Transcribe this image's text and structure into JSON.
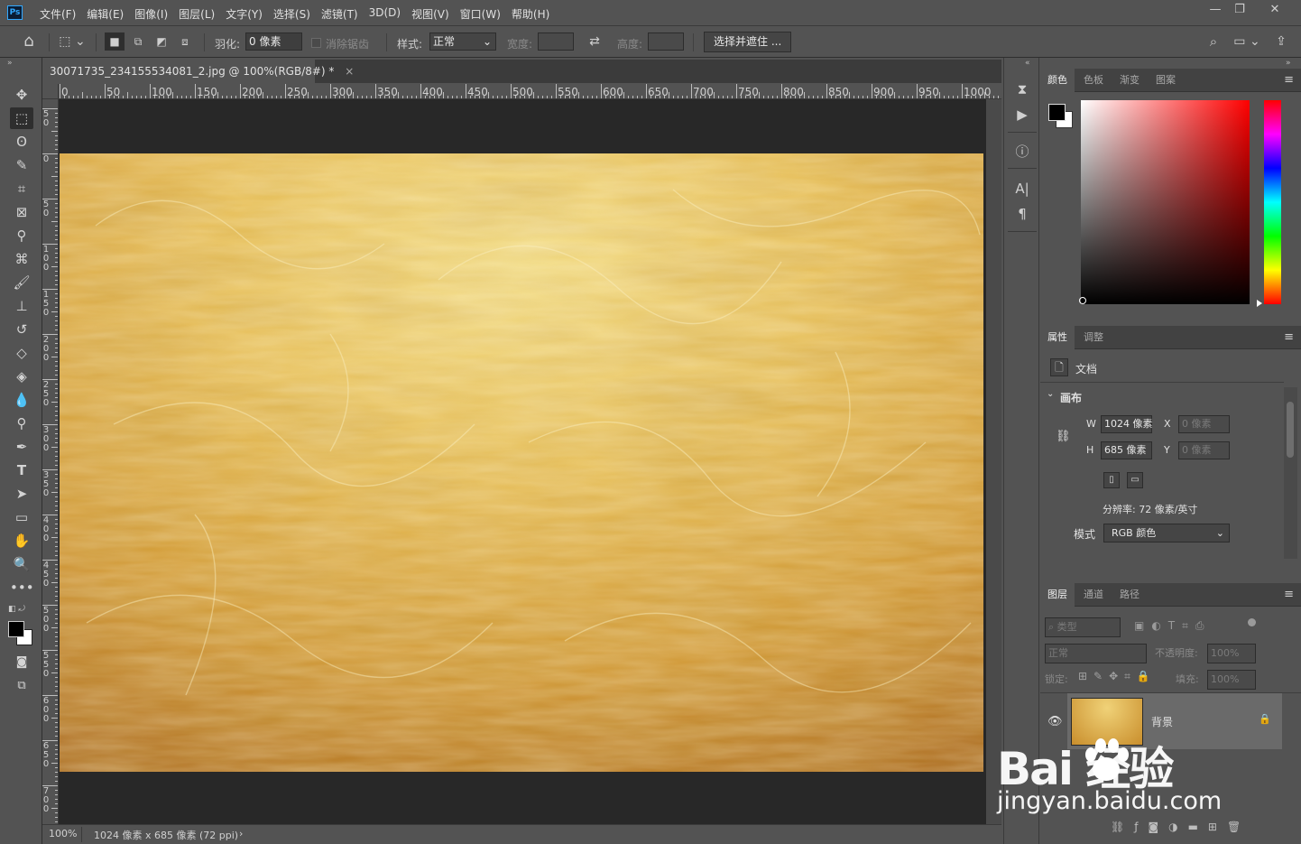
{
  "app": {
    "logo": "Ps"
  },
  "menu": [
    "文件(F)",
    "编辑(E)",
    "图像(I)",
    "图层(L)",
    "文字(Y)",
    "选择(S)",
    "滤镜(T)",
    "3D(D)",
    "视图(V)",
    "窗口(W)",
    "帮助(H)"
  ],
  "window_controls": {
    "minimize": "—",
    "restore": "❐",
    "close": "✕"
  },
  "options": {
    "feather_label": "羽化:",
    "feather_value": "0 像素",
    "antialias_label": "消除锯齿",
    "style_label": "样式:",
    "style_value": "正常",
    "width_label": "宽度:",
    "height_label": "高度:",
    "select_mask_button": "选择并遮住 ..."
  },
  "document_tab": {
    "title": "30071735_234155534081_2.jpg @ 100%(RGB/8#) *",
    "close": "×"
  },
  "ruler": {
    "h": [
      "0",
      "50",
      "100",
      "150",
      "200",
      "250",
      "300",
      "350",
      "400",
      "450",
      "500",
      "550",
      "600",
      "650",
      "700",
      "750",
      "800",
      "850",
      "900",
      "950",
      "1000"
    ],
    "v": [
      "50",
      "0",
      "50",
      "100",
      "150",
      "200",
      "250",
      "300",
      "350",
      "400",
      "450",
      "500",
      "550",
      "600",
      "650",
      "700"
    ]
  },
  "status": {
    "zoom": "100%",
    "dims": "1024 像素 x 685 像素 (72 ppi)",
    "arrow": "›"
  },
  "color_panel": {
    "tabs": [
      "颜色",
      "色板",
      "渐变",
      "图案"
    ]
  },
  "properties_panel": {
    "tabs": [
      "属性",
      "调整"
    ],
    "doc_label": "文档",
    "canvas_section": "画布",
    "w_label": "W",
    "w_value": "1024 像素",
    "h_label": "H",
    "h_value": "685 像素",
    "x_label": "X",
    "x_value": "0 像素",
    "y_label": "Y",
    "y_value": "0 像素",
    "resolution": "分辨率: 72 像素/英寸",
    "mode_label": "模式",
    "mode_value": "RGB 颜色"
  },
  "layers_panel": {
    "tabs": [
      "图层",
      "通道",
      "路径"
    ],
    "filter_placeholder": "类型",
    "blend_mode": "正常",
    "opacity_label": "不透明度:",
    "opacity_value": "100%",
    "lock_label": "锁定:",
    "fill_label": "填充:",
    "fill_value": "100%",
    "layer_name": "背景"
  },
  "watermark": {
    "brand": "Bai  经验",
    "url": "jingyan.baidu.com"
  },
  "colors": {
    "accent": "#31a8ff",
    "panel": "#535353",
    "canvas": "#282828"
  }
}
